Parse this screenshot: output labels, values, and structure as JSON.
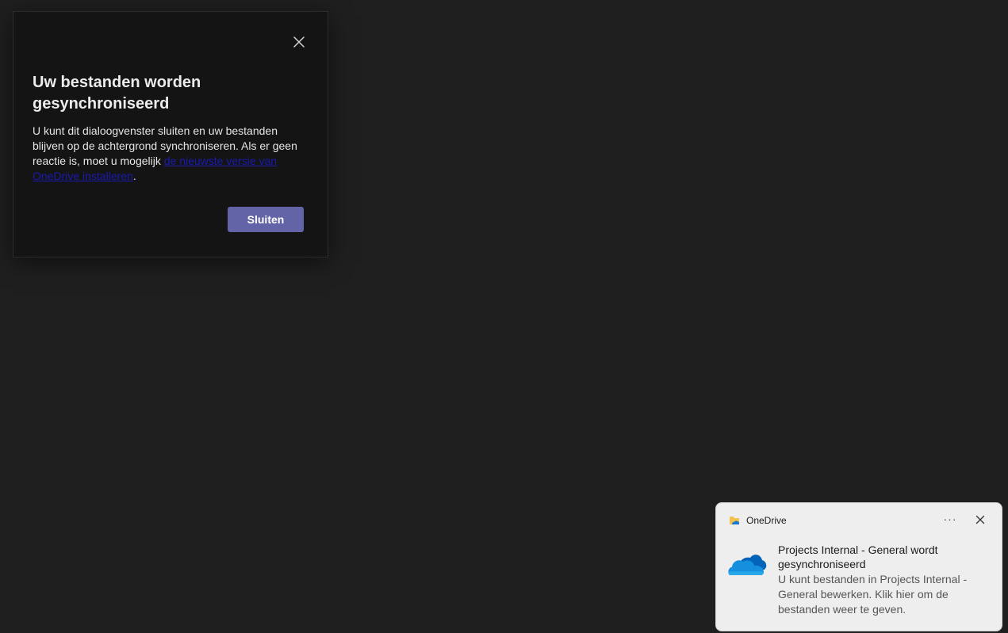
{
  "dialog": {
    "title": "Uw bestanden worden gesynchroniseerd",
    "body_text": "U kunt dit dialoogvenster sluiten en uw bestanden blijven op de achtergrond synchroniseren. Als er geen reactie is, moet u mogelijk ",
    "link_text": "de nieuwste versie van OneDrive installeren",
    "body_end": ".",
    "close_icon": "close-icon",
    "close_button_label": "Sluiten",
    "button_color": "#6264a7",
    "link_color": "#1a1ab0"
  },
  "toast": {
    "app_name": "OneDrive",
    "app_icon": "onedrive-folder-icon",
    "more_label": "···",
    "more_icon": "more-options-icon",
    "close_icon": "close-icon",
    "logo": "onedrive-cloud-icon",
    "title": "Projects Internal - General wordt gesynchroniseerd",
    "message": "U kunt bestanden in Projects Internal - General bewerken. Klik hier om de bestanden weer te geven."
  }
}
